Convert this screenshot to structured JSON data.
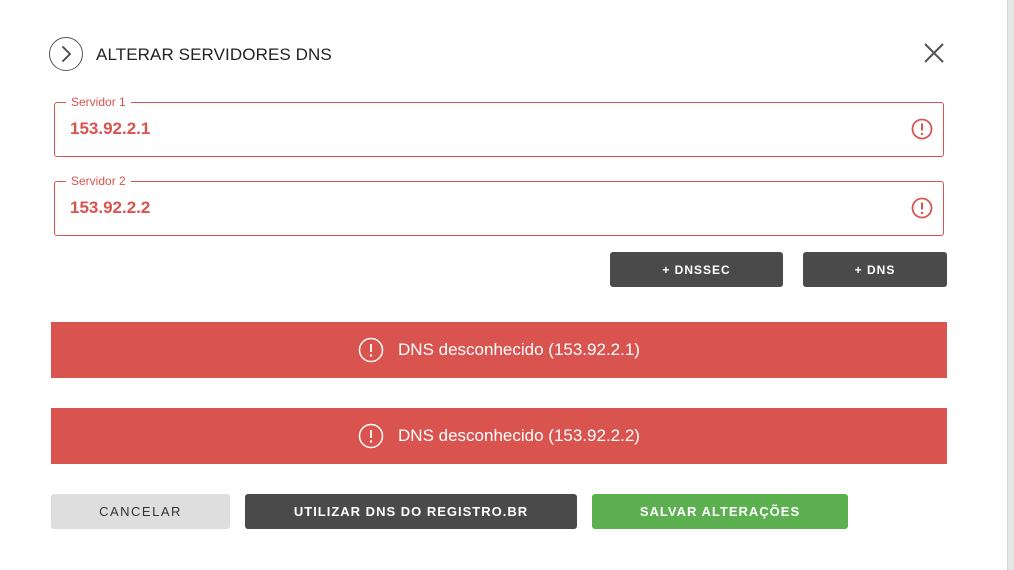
{
  "header": {
    "title": "ALTERAR SERVIDORES DNS",
    "back_icon": "chevron-right-icon",
    "close_icon": "close-icon"
  },
  "fields": [
    {
      "label": "Servidor 1",
      "value": "153.92.2.1",
      "status_icon": "alert-circle-icon"
    },
    {
      "label": "Servidor 2",
      "value": "153.92.2.2",
      "status_icon": "alert-circle-icon"
    }
  ],
  "actions": {
    "add_dnssec": "+ DNSSEC",
    "add_dns": "+ DNS"
  },
  "alerts": [
    {
      "message": "DNS desconhecido (153.92.2.1)",
      "icon": "alert-circle-icon"
    },
    {
      "message": "DNS desconhecido (153.92.2.2)",
      "icon": "alert-circle-icon"
    }
  ],
  "footer": {
    "cancel": "CANCELAR",
    "use_registro": "UTILIZAR DNS DO REGISTRO.BR",
    "save": "SALVAR ALTERAÇÕES"
  },
  "colors": {
    "error": "#d9534f",
    "dark_button": "#4a4a4a",
    "save_button": "#5cb050",
    "cancel_button": "#dedede"
  }
}
